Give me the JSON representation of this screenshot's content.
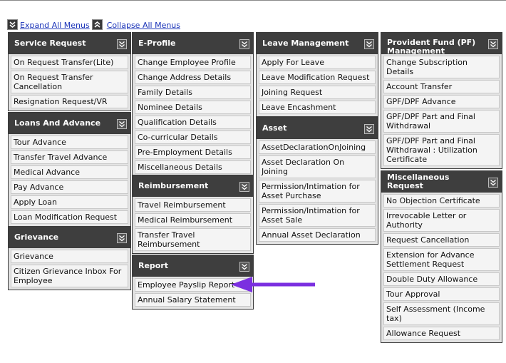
{
  "toolbar": {
    "expand_label": "Expand All Menus",
    "collapse_label": "Collapse All Menus"
  },
  "panels": {
    "service_request": {
      "title": "Service Request",
      "items": [
        "On Request Transfer(Lite)",
        "On Request Transfer Cancellation",
        "Resignation Request/VR"
      ]
    },
    "loans_advance": {
      "title": "Loans And Advance",
      "items": [
        "Tour Advance",
        "Transfer Travel Advance",
        "Medical Advance",
        "Pay Advance",
        "Apply Loan",
        "Loan Modification Request"
      ]
    },
    "grievance": {
      "title": "Grievance",
      "items": [
        "Grievance",
        "Citizen Grievance Inbox For Employee"
      ]
    },
    "e_profile": {
      "title": "E-Profile",
      "items": [
        "Change Employee Profile",
        "Change Address Details",
        "Family Details",
        "Nominee Details",
        "Qualification Details",
        "Co-curricular Details",
        "Pre-Employment Details",
        "Miscellaneous Details"
      ]
    },
    "reimbursement": {
      "title": "Reimbursement",
      "items": [
        "Travel Reimbursement",
        "Medical Reimbursement",
        "Transfer Travel Reimbursement"
      ]
    },
    "report": {
      "title": "Report",
      "items": [
        "Employee Payslip Report",
        "Annual Salary Statement"
      ]
    },
    "leave_management": {
      "title": "Leave Management",
      "items": [
        "Apply For Leave",
        "Leave Modification Request",
        "Joining Request",
        "Leave Encashment"
      ]
    },
    "asset": {
      "title": "Asset",
      "items": [
        "AssetDeclarationOnJoining",
        "Asset Declaration On Joining",
        "Permission/Intimation for Asset Purchase",
        "Permission/Intimation for Asset Sale",
        "Annual Asset Declaration"
      ]
    },
    "provident_fund": {
      "title": "Provident Fund (PF) Management",
      "items": [
        "Change Subscription Details",
        "Account Transfer",
        "GPF/DPF Advance",
        "GPF/DPF Part and Final Withdrawal",
        "GPF/DPF Part and Final Withdrawal : Utilization Certificate"
      ]
    },
    "miscellaneous_request": {
      "title": "Miscellaneous Request",
      "items": [
        "No Objection Certificate",
        "Irrevocable Letter or Authority",
        "Request Cancellation",
        "Extension for Advance Settlement Request",
        "Double Duty Allowance",
        "Tour Approval",
        "Self Assessment (Income tax)",
        "Allowance Request"
      ]
    }
  },
  "annotation": {
    "arrow_color": "#7b2fe0"
  }
}
